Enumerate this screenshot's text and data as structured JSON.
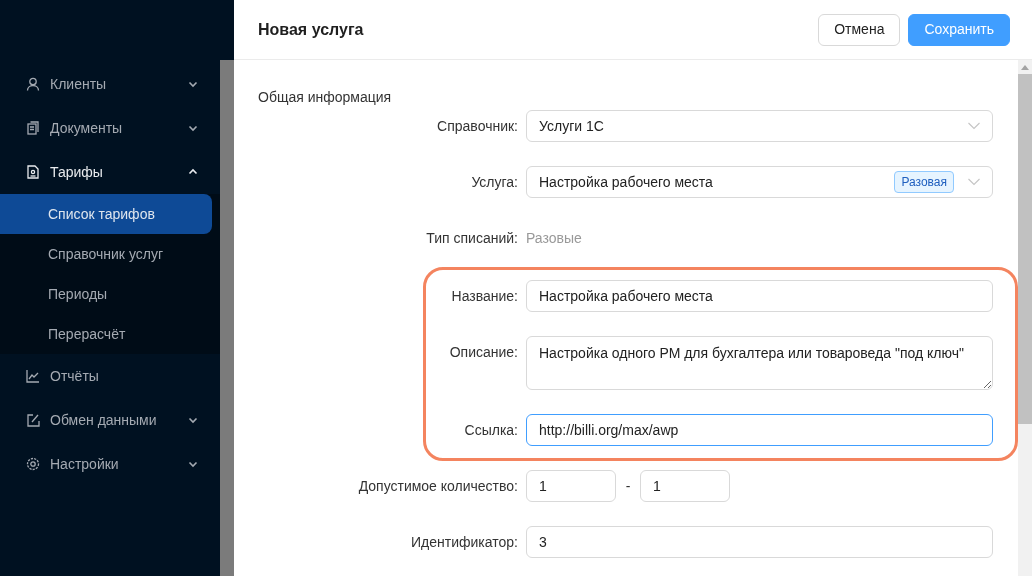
{
  "sidebar": {
    "items": [
      {
        "label": "Клиенты",
        "expanded": false
      },
      {
        "label": "Документы",
        "expanded": false
      },
      {
        "label": "Тарифы",
        "expanded": true,
        "children": [
          {
            "label": "Список тарифов",
            "selected": true
          },
          {
            "label": "Справочник услуг",
            "selected": false
          },
          {
            "label": "Периоды",
            "selected": false
          },
          {
            "label": "Перерасчёт",
            "selected": false
          }
        ]
      },
      {
        "label": "Отчёты"
      },
      {
        "label": "Обмен данными",
        "expanded": false
      },
      {
        "label": "Настройки",
        "expanded": false
      }
    ]
  },
  "drawer": {
    "title": "Новая услуга",
    "buttons": [
      {
        "label": "Отмена",
        "kind": "default"
      },
      {
        "label": "Сохранить",
        "kind": "primary"
      }
    ],
    "section_title": "Общая информация",
    "fields": [
      {
        "kind": "select",
        "label": "Справочник:",
        "value": "Услуги 1С",
        "highlighted": false
      },
      {
        "kind": "select",
        "label": "Услуга:",
        "value": "Настройка рабочего места",
        "tag": "Разовая",
        "highlighted": false
      },
      {
        "kind": "static",
        "label": "Тип списаний:",
        "value": "Разовые",
        "highlighted": false
      },
      {
        "kind": "input",
        "label": "Название:",
        "value": "Настройка рабочего места",
        "focused": false,
        "highlighted": true
      },
      {
        "kind": "textarea",
        "label": "Описание:",
        "value": "Настройка одного РМ для бухгалтера или товароведа \"под ключ\"",
        "focused": false,
        "highlighted": true
      },
      {
        "kind": "input",
        "label": "Ссылка:",
        "value": "http://billi.org/max/awp",
        "focused": true,
        "highlighted": true
      },
      {
        "kind": "range",
        "label": "Допустимое количество:",
        "from": "1",
        "separator": "-",
        "to": "1",
        "highlighted": false
      },
      {
        "kind": "input",
        "label": "Идентификатор:",
        "value": "3",
        "focused": false,
        "highlighted": false
      }
    ]
  }
}
